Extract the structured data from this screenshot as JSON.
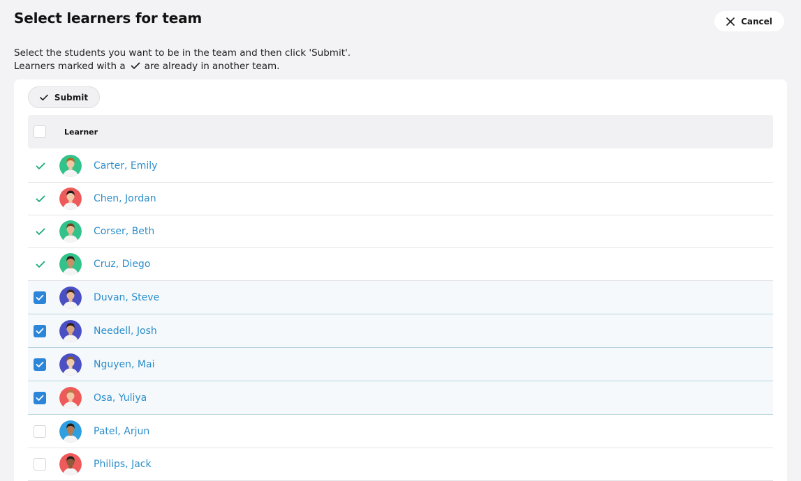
{
  "header": {
    "title": "Select learners for team",
    "cancel_label": "Cancel"
  },
  "intro": {
    "line1": "Select the students you want to be in the team and then click 'Submit'.",
    "line2_before": "Learners marked with a",
    "line2_after": "are already in another team."
  },
  "toolbar": {
    "submit_label": "Submit"
  },
  "table": {
    "columns": [
      "Learner"
    ],
    "rows": [
      {
        "name": "Carter, Emily",
        "state": "in-other-team",
        "avatar_bg": "#33c28a",
        "skin": "#f2c6a5",
        "hair": "#b5651d"
      },
      {
        "name": "Chen, Jordan",
        "state": "in-other-team",
        "avatar_bg": "#ee5a5a",
        "skin": "#f0c9a8",
        "hair": "#1d1d1d"
      },
      {
        "name": "Corser, Beth",
        "state": "in-other-team",
        "avatar_bg": "#33c28a",
        "skin": "#e8b794",
        "hair": "#6b4423"
      },
      {
        "name": "Cruz, Diego",
        "state": "in-other-team",
        "avatar_bg": "#33c28a",
        "skin": "#c88e66",
        "hair": "#2a1a10"
      },
      {
        "name": "Duvan, Steve",
        "state": "checked",
        "avatar_bg": "#4a4fc4",
        "skin": "#e6b896",
        "hair": "#3a2a1a"
      },
      {
        "name": "Needell, Josh",
        "state": "checked",
        "avatar_bg": "#4a4fc4",
        "skin": "#d9a67c",
        "hair": "#2a1a10"
      },
      {
        "name": "Nguyen, Mai",
        "state": "checked",
        "avatar_bg": "#4a4fc4",
        "skin": "#f0cba9",
        "hair": "#8a5a2b"
      },
      {
        "name": "Osa, Yuliya",
        "state": "checked",
        "avatar_bg": "#ee5a5a",
        "skin": "#f2c6a5",
        "hair": "#b87b3d"
      },
      {
        "name": "Patel, Arjun",
        "state": "unchecked",
        "avatar_bg": "#2f9fe0",
        "skin": "#b57a52",
        "hair": "#1d1d1d"
      },
      {
        "name": "Philips, Jack",
        "state": "unchecked",
        "avatar_bg": "#ee5a5a",
        "skin": "#8f5a3a",
        "hair": "#1d1d1d"
      }
    ]
  },
  "colors": {
    "accent": "#2b86d9",
    "link": "#2b8ecb",
    "tick_green": "#1aa87a"
  }
}
